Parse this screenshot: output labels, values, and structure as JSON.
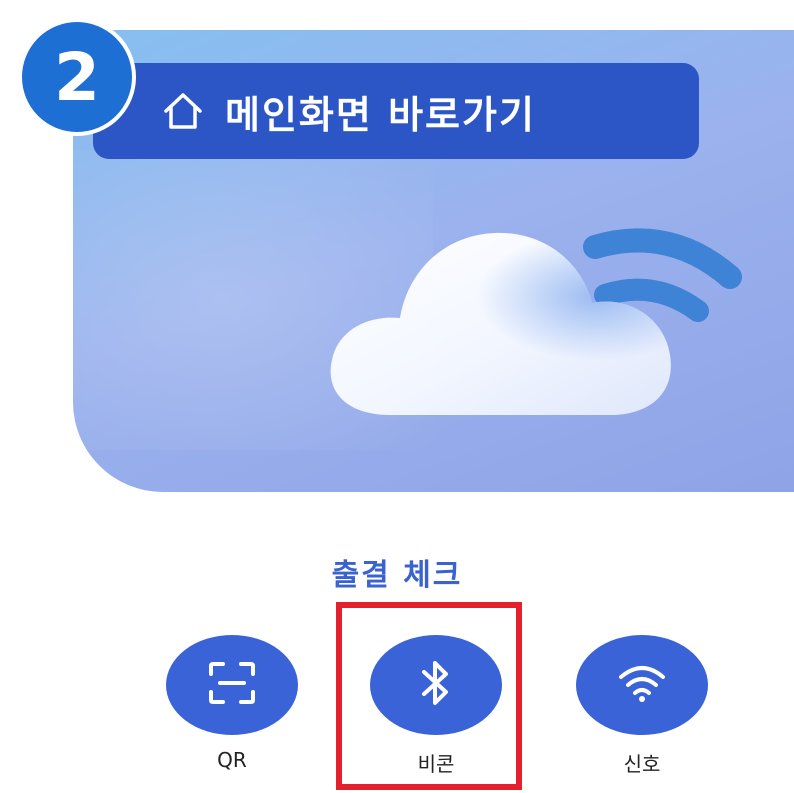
{
  "step_badge": {
    "number": "2"
  },
  "home_button": {
    "label": "메인화면 바로가기",
    "icon": "home-icon"
  },
  "attendance": {
    "title": "출결 체크",
    "options": [
      {
        "label": "QR",
        "icon": "qr-scan-icon"
      },
      {
        "label": "비콘",
        "icon": "bluetooth-icon"
      },
      {
        "label": "신호",
        "icon": "wifi-icon"
      }
    ],
    "highlighted_option": "비콘"
  },
  "colors": {
    "accent": "#3a63d8",
    "badge": "#1d6fd4",
    "home_button": "#2c56c6",
    "highlight": "#e4202d"
  }
}
